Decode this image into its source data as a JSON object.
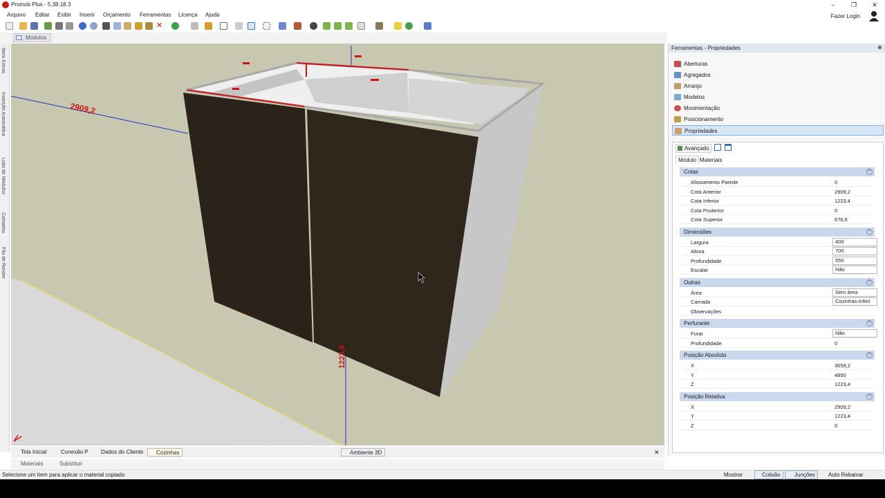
{
  "window": {
    "title": "Promob Plus - 5.38.18.3",
    "controls": [
      "–",
      "❐",
      "✕"
    ]
  },
  "menu": [
    "Arquivo",
    "Editar",
    "Exibir",
    "Inserir",
    "Orçamento",
    "Ferramentas",
    "Licença",
    "Ajuda"
  ],
  "user": {
    "login_label": "Fazer Login"
  },
  "doc_tab": "Módulos",
  "left_tabs": [
    "Itens Extras",
    "Inserção Automática",
    "Lista de Módulos",
    "Camadas",
    "Fila de Render"
  ],
  "viewport": {
    "dims": {
      "left": "2909,2",
      "front": "1223,4",
      "top_mark": "0"
    }
  },
  "bottom_tabs": [
    "Tela Inicial",
    "Conexão P",
    "Dados do Cliente",
    "Cozinhas"
  ],
  "center_tab": "Ambiente 3D",
  "close_glyph": "✕",
  "row2_tabs": [
    "Materiais",
    "Substituir"
  ],
  "status": {
    "message": "Selecione um item para aplicar o material copiado",
    "buttons": [
      "Mostrar",
      "Colisão",
      "Junções",
      "Auto Rebaixar"
    ]
  },
  "panel": {
    "title": "Ferramentas - Propriedades",
    "pin": "⊕",
    "tools": [
      "Aberturas",
      "Agregados",
      "Arranjo",
      "Modelos",
      "Movimentação",
      "Posicionamento",
      "Propriedades"
    ],
    "selected_tool": "Propriedades",
    "advanced_label": "Avançado",
    "subtabs": [
      "Módulo",
      "Materiais"
    ],
    "sections": [
      {
        "title": "Cotas",
        "rows": [
          [
            "Afastamento Parede",
            "0"
          ],
          [
            "Cota Anterior",
            "2909,2"
          ],
          [
            "Cota Inferior",
            "1223,4"
          ],
          [
            "Cota Posterior",
            "0"
          ],
          [
            "Cota Superior",
            "676,6"
          ]
        ]
      },
      {
        "title": "Dimensões",
        "rows": [
          [
            "Largura",
            "400"
          ],
          [
            "Altura",
            "700"
          ],
          [
            "Profundidade",
            "550"
          ],
          [
            "Escalar",
            "Não"
          ]
        ]
      },
      {
        "title": "Outras",
        "rows": [
          [
            "Área",
            "Sem área"
          ],
          [
            "Camada",
            "Cozinhas-Inferi"
          ],
          [
            "Observações",
            ""
          ]
        ]
      },
      {
        "title": "Perfurante",
        "rows": [
          [
            "Furar",
            "Não"
          ],
          [
            "Profundidade",
            "0"
          ]
        ]
      },
      {
        "title": "Posição Absoluta",
        "rows": [
          [
            "X",
            "3059,2"
          ],
          [
            "Y",
            "4850"
          ],
          [
            "Z",
            "1223,4"
          ]
        ]
      },
      {
        "title": "Posição Relativa",
        "rows": [
          [
            "X",
            "2909,2"
          ],
          [
            "Y",
            "1223,4"
          ],
          [
            "Z",
            "0"
          ]
        ]
      }
    ]
  },
  "colors": {
    "door": "#2b2219",
    "carcass": "#dcdcdc",
    "floor": "#d9d9d9",
    "wall": "#c8c7af",
    "dim_red": "#d01414",
    "axis_blue": "#2230c8"
  }
}
